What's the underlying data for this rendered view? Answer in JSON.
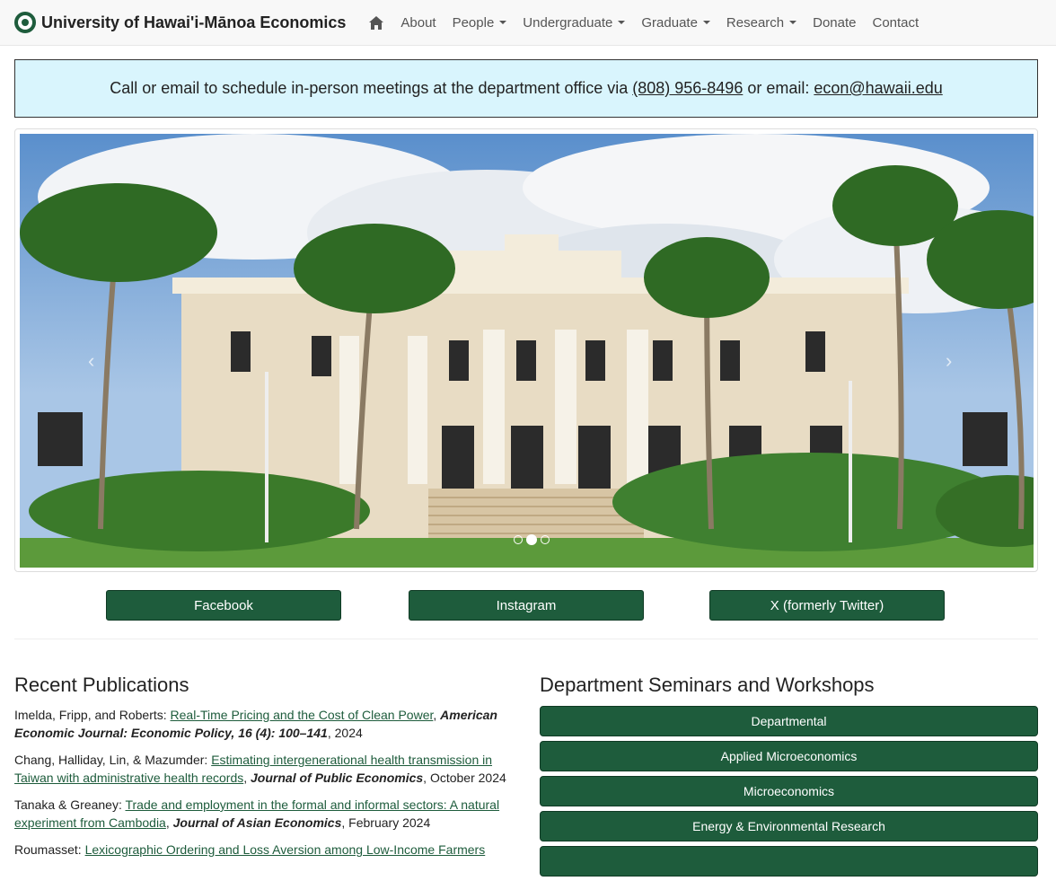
{
  "brand": {
    "title": "University of Hawai'i-Mānoa Economics"
  },
  "nav": {
    "items": [
      {
        "label": "About",
        "dropdown": false
      },
      {
        "label": "People",
        "dropdown": true
      },
      {
        "label": "Undergraduate",
        "dropdown": true
      },
      {
        "label": "Graduate",
        "dropdown": true
      },
      {
        "label": "Research",
        "dropdown": true
      },
      {
        "label": "Donate",
        "dropdown": false
      },
      {
        "label": "Contact",
        "dropdown": false
      }
    ]
  },
  "notice": {
    "text": "Call or email to schedule in-person meetings at the department office via ",
    "phone": "(808) 956-8496",
    "mid": " or email: ",
    "email": "econ@hawaii.edu"
  },
  "carousel": {
    "prev": "‹",
    "next": "›",
    "slide_count": 3,
    "active_slide": 2
  },
  "social": {
    "facebook": "Facebook",
    "instagram": "Instagram",
    "x": "X (formerly Twitter)"
  },
  "publications": {
    "heading": "Recent Publications",
    "items": [
      {
        "authors": "Imelda, Fripp, and Roberts: ",
        "title": "Real-Time Pricing and the Cost of Clean Power",
        "journal": "American Economic Journal: Economic Policy, 16 (4): 100–141",
        "date": ", 2024"
      },
      {
        "authors": "Chang, Halliday, Lin, & Mazumder: ",
        "title": "Estimating intergenerational health transmission in Taiwan with administrative health records",
        "journal": "Journal of Public Economics",
        "date": ", October 2024"
      },
      {
        "authors": "Tanaka & Greaney: ",
        "title": "Trade and employment in the formal and informal sectors: A natural experiment from Cambodia",
        "journal": "Journal of Asian Economics",
        "date": ", February 2024"
      },
      {
        "authors": "Roumasset: ",
        "title": "Lexicographic Ordering and Loss Aversion among Low-Income Farmers",
        "journal": "",
        "date": ""
      }
    ]
  },
  "seminars": {
    "heading": "Department Seminars and Workshops",
    "items": [
      "Departmental",
      "Applied Microeconomics",
      "Microeconomics",
      "Energy & Environmental Research",
      ""
    ]
  },
  "colors": {
    "brand_green": "#1e5c3c",
    "notice_bg": "#d9f5fd"
  }
}
